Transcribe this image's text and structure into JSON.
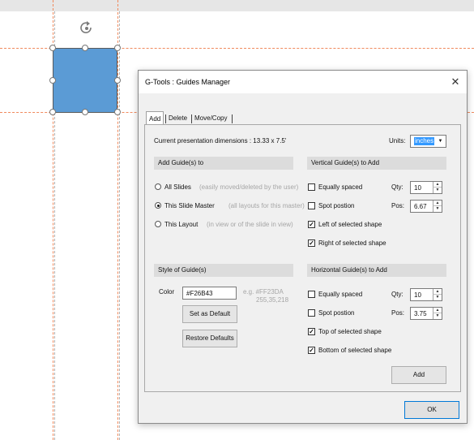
{
  "dialog": {
    "title": "G-Tools : Guides Manager",
    "close_glyph": "✕",
    "tabs": [
      "Add",
      "Delete",
      "Move/Copy"
    ],
    "dimensions_text": "Current presentation dimensions : 13.33 x 7.5'",
    "units_label": "Units:",
    "units_value": "inches",
    "add_to_section": "Add Guide(s) to",
    "radios": [
      {
        "label": "All Slides",
        "hint": "(easily moved/deleted by the user)",
        "selected": false
      },
      {
        "label": "This Slide Master",
        "hint": "(all layouts for this master)",
        "selected": true
      },
      {
        "label": "This Layout",
        "hint": "(in view or of the slide in view)",
        "selected": false
      }
    ],
    "vertical_section": "Vertical Guide(s) to Add",
    "vertical": {
      "equally_spaced": "Equally spaced",
      "spot_position": "Spot postion",
      "qty_label": "Qty:",
      "qty_value": "10",
      "pos_label": "Pos:",
      "pos_value": "6.67",
      "left_label": "Left of selected shape",
      "right_label": "Right of selected shape"
    },
    "style_section": "Style of Guide(s)",
    "color_label": "Color",
    "color_value": "#F26B43",
    "eg_text": "e.g. #FF23DA",
    "eg_rgb": "255,35,218",
    "set_default_button": "Set as Default",
    "restore_defaults_button": "Restore Defaults",
    "horizontal_section": "Horizontal Guide(s) to Add",
    "horizontal": {
      "equally_spaced": "Equally spaced",
      "spot_position": "Spot postion",
      "qty_label": "Qty:",
      "qty_value": "10",
      "pos_label": "Pos:",
      "pos_value": "3.75",
      "top_label": "Top of selected shape",
      "bottom_label": "Bottom of selected shape"
    },
    "add_button": "Add",
    "ok_button": "OK"
  },
  "colors": {
    "guide": "#F26B43",
    "shape_fill": "#5B9BD5",
    "accent": "#0078D7"
  }
}
